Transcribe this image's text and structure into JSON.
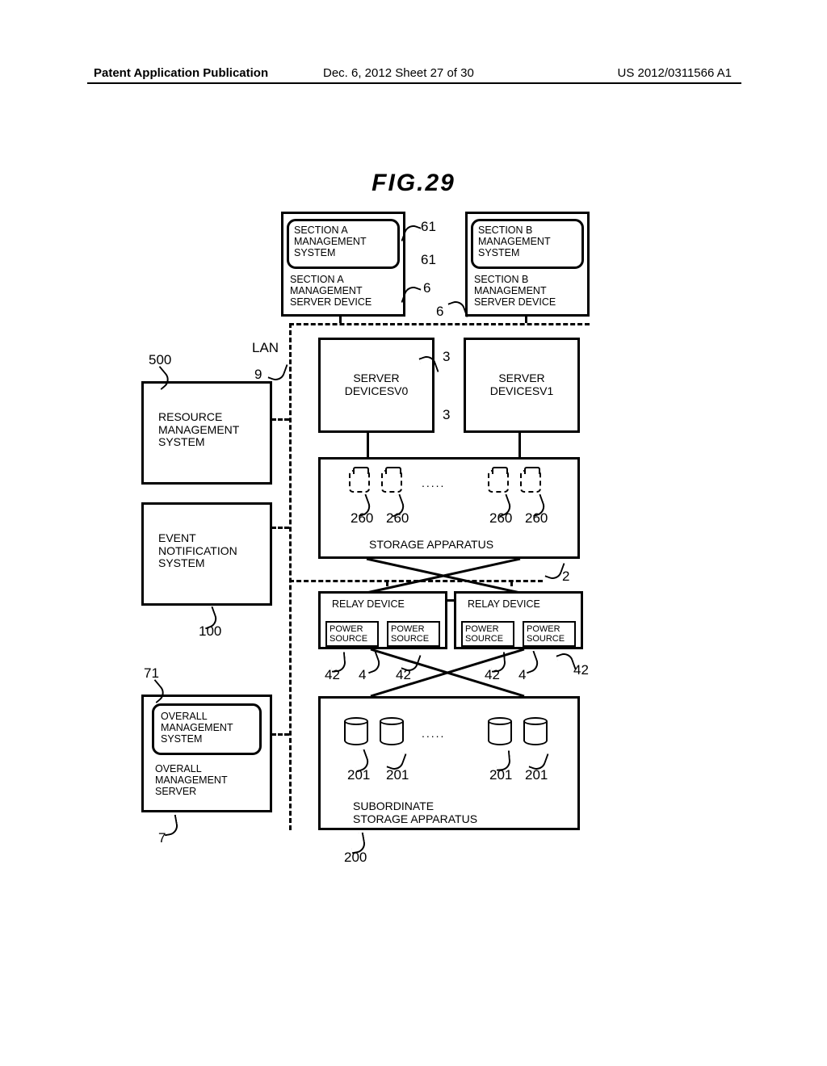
{
  "header": {
    "left": "Patent Application Publication",
    "center": "Dec. 6, 2012  Sheet 27 of 30",
    "right": "US 2012/0311566 A1"
  },
  "figure_title": "FIG.29",
  "boxes": {
    "sectionA_inner": "SECTION A\nMANAGEMENT\nSYSTEM",
    "sectionA_outer": "SECTION A\nMANAGEMENT\nSERVER DEVICE",
    "sectionB_inner": "SECTION B\nMANAGEMENT\nSYSTEM",
    "sectionB_outer": "SECTION B\nMANAGEMENT\nSERVER DEVICE",
    "server0": "SERVER\nDEVICESV0",
    "server1": "SERVER\nDEVICESV1",
    "resource": "RESOURCE\nMANAGEMENT\nSYSTEM",
    "event": "EVENT\nNOTIFICATION\nSYSTEM",
    "storage_app": "STORAGE APPARATUS",
    "relay1": "RELAY DEVICE",
    "relay2": "RELAY DEVICE",
    "power": "POWER\nSOURCE",
    "overall_inner": "OVERALL\nMANAGEMENT\nSYSTEM",
    "overall_outer": "OVERALL\nMANAGEMENT\nSERVER",
    "sub_storage": "SUBORDINATE\nSTORAGE APPARATUS"
  },
  "labels": {
    "lan": "LAN"
  },
  "refs": {
    "r61a": "61",
    "r61b": "61",
    "r6a": "6",
    "r6b": "6",
    "r9": "9",
    "r3a": "3",
    "r3b": "3",
    "r500": "500",
    "r100": "100",
    "r260a": "260",
    "r260b": "260",
    "r260c": "260",
    "r260d": "260",
    "r2": "2",
    "r4a": "4",
    "r4b": "4",
    "r42a": "42",
    "r42b": "42",
    "r42c": "42",
    "r42d": "42",
    "r71": "71",
    "r7": "7",
    "r201a": "201",
    "r201b": "201",
    "r201c": "201",
    "r201d": "201",
    "r200": "200"
  },
  "dots": "....."
}
